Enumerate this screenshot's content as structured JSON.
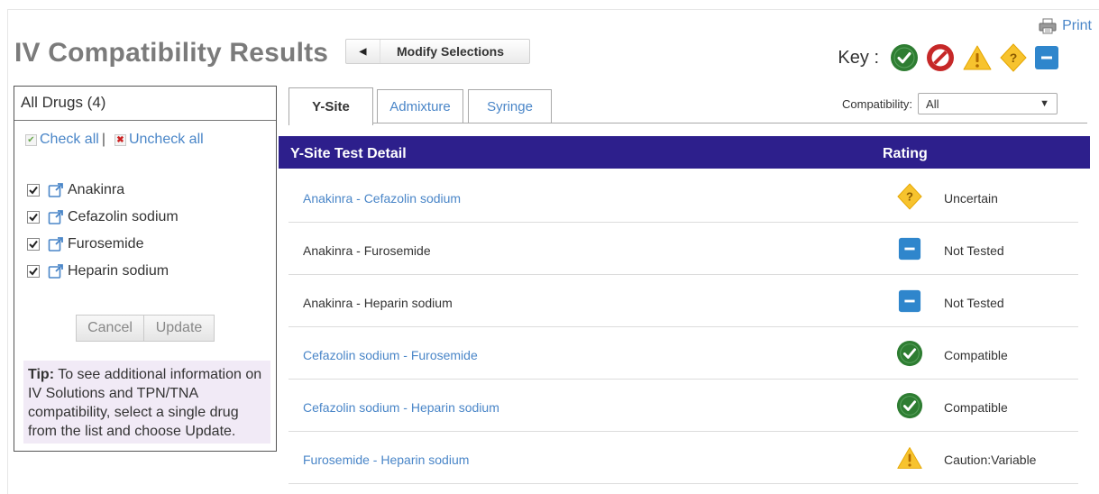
{
  "header": {
    "title": "IV Compatibility Results",
    "modify_label": "Modify Selections",
    "print_label": "Print",
    "key_label": "Key :",
    "key_icons": [
      "compatible-icon",
      "incompatible-icon",
      "caution-icon",
      "uncertain-icon",
      "not-tested-icon"
    ]
  },
  "left_panel": {
    "heading": "All Drugs (4)",
    "check_all": "Check all",
    "separator": "|",
    "uncheck_all": "Uncheck all",
    "drugs": [
      {
        "label": "Anakinra",
        "checked": true
      },
      {
        "label": "Cefazolin sodium",
        "checked": true
      },
      {
        "label": "Furosemide",
        "checked": true
      },
      {
        "label": "Heparin sodium",
        "checked": true
      }
    ],
    "cancel_label": "Cancel",
    "update_label": "Update",
    "tip_label": "Tip:",
    "tip_text": " To see additional information on IV Solutions and TPN/TNA compatibility, select a single drug from the list and choose Update."
  },
  "tabs": [
    {
      "label": "Y-Site",
      "active": true
    },
    {
      "label": "Admixture",
      "active": false
    },
    {
      "label": "Syringe",
      "active": false
    }
  ],
  "filter": {
    "label": "Compatibility:",
    "value": "All"
  },
  "results": {
    "col_detail": "Y-Site Test Detail",
    "col_rating": "Rating",
    "rows": [
      {
        "pair": "Anakinra - Cefazolin sodium",
        "link": true,
        "rating": "Uncertain",
        "icon": "uncertain-icon"
      },
      {
        "pair": "Anakinra - Furosemide",
        "link": false,
        "rating": "Not Tested",
        "icon": "not-tested-icon"
      },
      {
        "pair": "Anakinra - Heparin sodium",
        "link": false,
        "rating": "Not Tested",
        "icon": "not-tested-icon"
      },
      {
        "pair": "Cefazolin sodium - Furosemide",
        "link": true,
        "rating": "Compatible",
        "icon": "compatible-icon"
      },
      {
        "pair": "Cefazolin sodium - Heparin sodium",
        "link": true,
        "rating": "Compatible",
        "icon": "compatible-icon"
      },
      {
        "pair": "Furosemide - Heparin sodium",
        "link": true,
        "rating": "Caution:Variable",
        "icon": "caution-icon"
      }
    ]
  },
  "colors": {
    "header_bar": "#2d1f8c",
    "link": "#4a86c8",
    "compatible": "#2e7d32",
    "incompatible": "#c62828",
    "caution": "#f7c32e",
    "not_tested": "#2f86cc",
    "tip_bg": "#f1eaf6"
  }
}
